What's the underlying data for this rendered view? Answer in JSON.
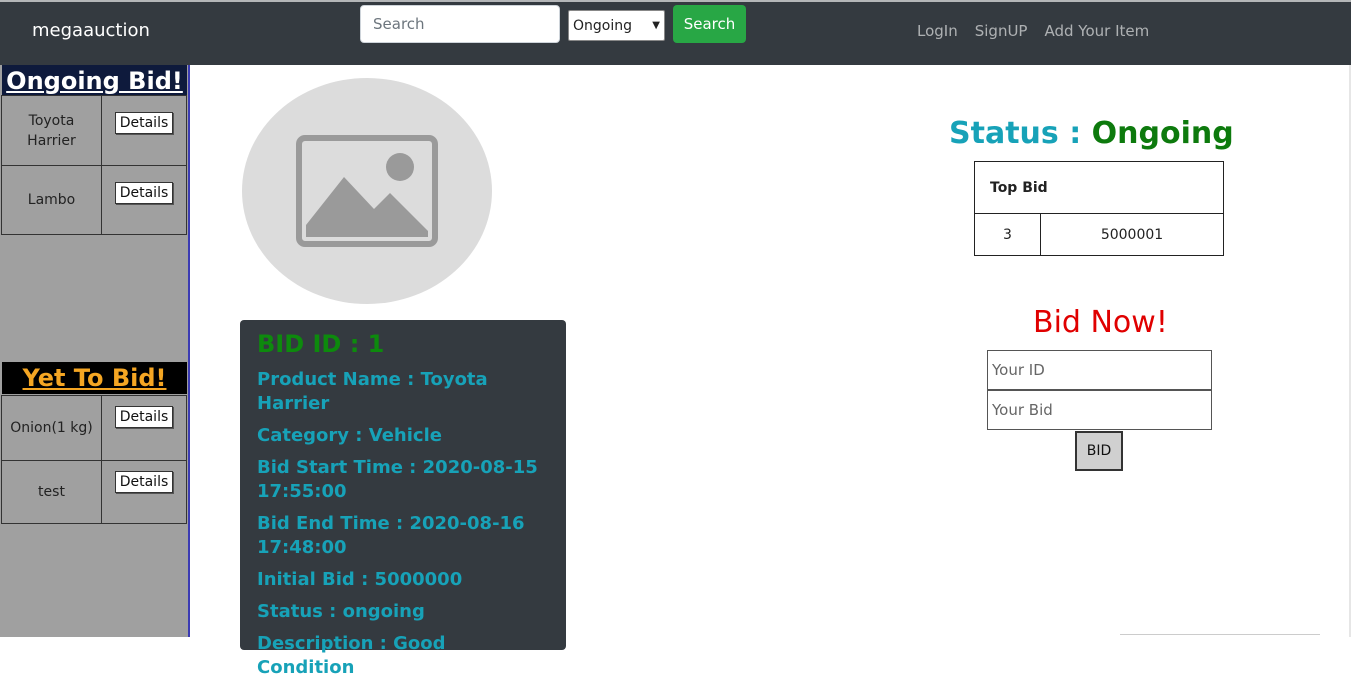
{
  "navbar": {
    "brand": "megaauction",
    "search_placeholder": "Search",
    "select_value": "Ongoing",
    "search_button": "Search",
    "links": [
      "LogIn",
      "SignUP",
      "Add Your Item"
    ]
  },
  "sidebar": {
    "ongoing_title": "Ongoing Bid!",
    "ongoing_items": [
      {
        "name": "Toyota Harrier",
        "button": "Details"
      },
      {
        "name": "Lambo",
        "button": "Details"
      }
    ],
    "yet_title": "Yet To Bid!",
    "yet_items": [
      {
        "name": "Onion(1 kg)",
        "button": "Details"
      },
      {
        "name": "test",
        "button": "Details"
      }
    ]
  },
  "product": {
    "bid_id": "BID ID : 1",
    "name": "Product Name : Toyota Harrier",
    "category": "Category : Vehicle",
    "start": "Bid Start Time : 2020-08-15 17:55:00",
    "end": "Bid End Time : 2020-08-16 17:48:00",
    "initial": "Initial Bid : 5000000",
    "status": "Status : ongoing",
    "description": "Description : Good Condition"
  },
  "status": {
    "label": "Status :",
    "value": "Ongoing"
  },
  "top_bid": {
    "header": "Top Bid",
    "id": "3",
    "amount": "5000001"
  },
  "bid_form": {
    "title": "Bid Now!",
    "id_placeholder": "Your ID",
    "bid_placeholder": "Your Bid",
    "button": "BID"
  }
}
